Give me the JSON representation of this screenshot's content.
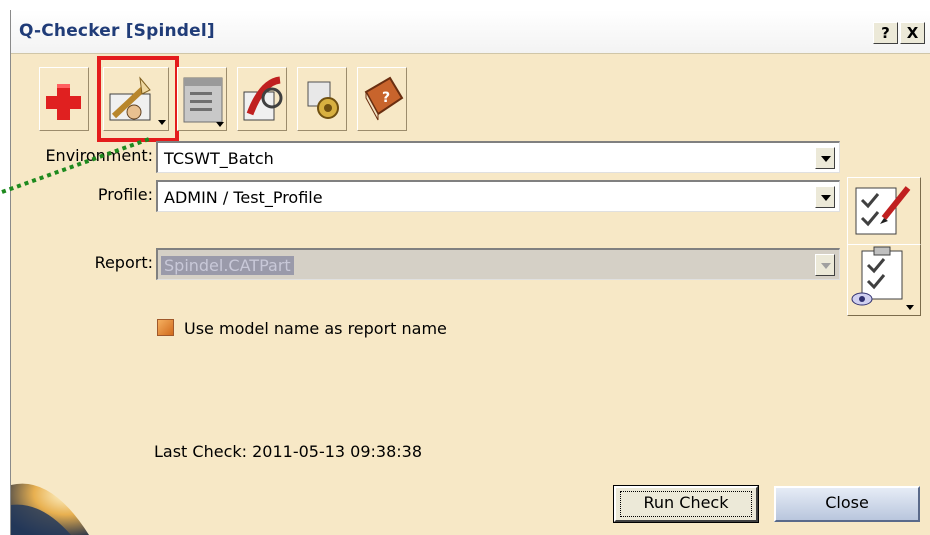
{
  "window": {
    "title": "Q-Checker [Spindel]",
    "help_button": "?",
    "close_button": "X"
  },
  "toolbar": {
    "items": [
      {
        "icon": "add-cross-icon"
      },
      {
        "icon": "environment-settings-icon"
      },
      {
        "icon": "list-window-icon"
      },
      {
        "icon": "analysis-icon"
      },
      {
        "icon": "gear-settings-icon"
      },
      {
        "icon": "help-book-icon"
      }
    ],
    "highlighted_index": 1
  },
  "form": {
    "environment_label": "Environment:",
    "environment_value": "TCSWT_Batch",
    "profile_label": "Profile:",
    "profile_value": "ADMIN / Test_Profile",
    "report_label": "Report:",
    "report_value": "Spindel.CATPart",
    "use_model_name_label": "Use model name as report name",
    "use_model_name_checked": true
  },
  "status": {
    "last_check": "Last Check: 2011-05-13 09:38:38"
  },
  "buttons": {
    "run_check": "Run Check",
    "close": "Close"
  },
  "colors": {
    "background": "#f7e8c6",
    "title_text": "#203c78",
    "highlight": "#e41c1c",
    "annotation": "#1e8a1e"
  }
}
